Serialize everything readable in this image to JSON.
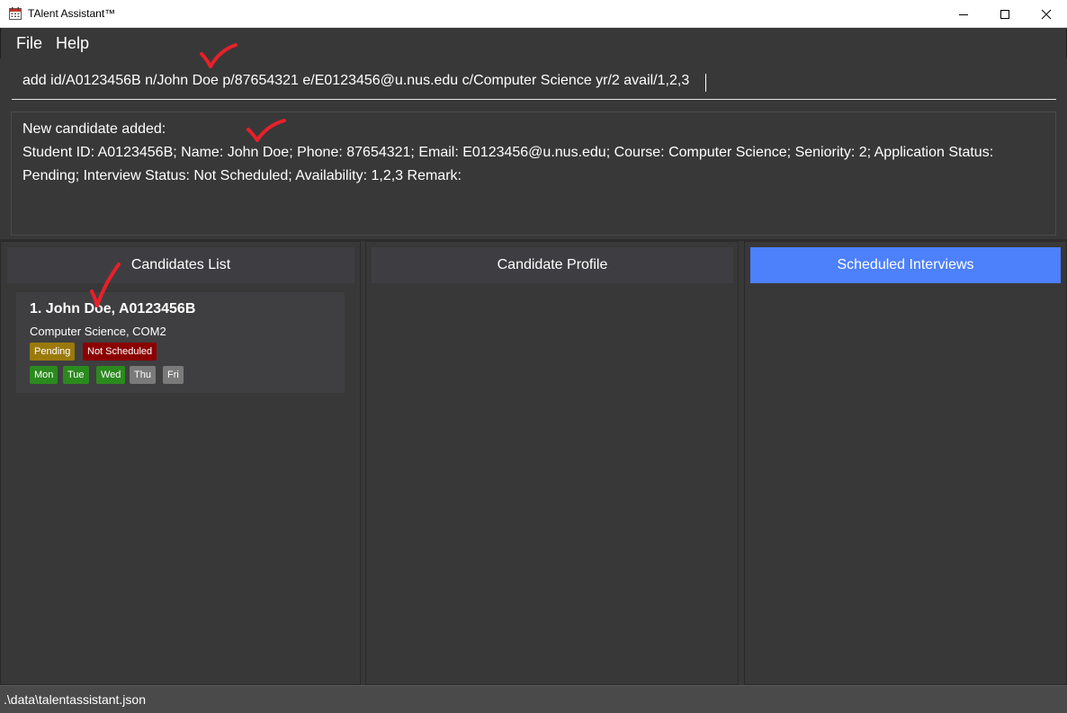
{
  "window": {
    "title": "TAlent Assistant™",
    "icon": "calendar-icon"
  },
  "menu": {
    "file": "File",
    "help": "Help"
  },
  "command_box": {
    "value": "add id/A0123456B n/John Doe p/87654321 e/E0123456@u.nus.edu c/Computer Science yr/2 avail/1,2,3"
  },
  "result_display": {
    "line1": "New candidate added:",
    "line2": "Student ID: A0123456B; Name: John Doe; Phone: 87654321; Email: E0123456@u.nus.edu; Course: Computer Science; Seniority: 2; Application Status:",
    "line3": "Pending; Interview Status: Not Scheduled; Availability: 1,2,3 Remark:"
  },
  "panels": {
    "candidates_list": "Candidates List",
    "candidate_profile": "Candidate Profile",
    "scheduled_interviews": "Scheduled Interviews"
  },
  "candidates": [
    {
      "title": "1.  John Doe, A0123456B",
      "subtitle": "Computer Science, COM2",
      "application_status": "Pending",
      "interview_status": "Not Scheduled",
      "days": [
        "Mon",
        "Tue",
        "Wed",
        "Thu",
        "Fri"
      ]
    }
  ],
  "status_bar": {
    "path": ".\\data\\talentassistant.json"
  },
  "colors": {
    "background": "#383838",
    "accent_active_tab": "#4d80fb",
    "pending_tag": "#9b7a0b",
    "not_scheduled_tag": "#8b0000",
    "available_day": "#2b8a1e",
    "unavailable_day": "#7a7a7a",
    "annotation": "#e8202a"
  }
}
